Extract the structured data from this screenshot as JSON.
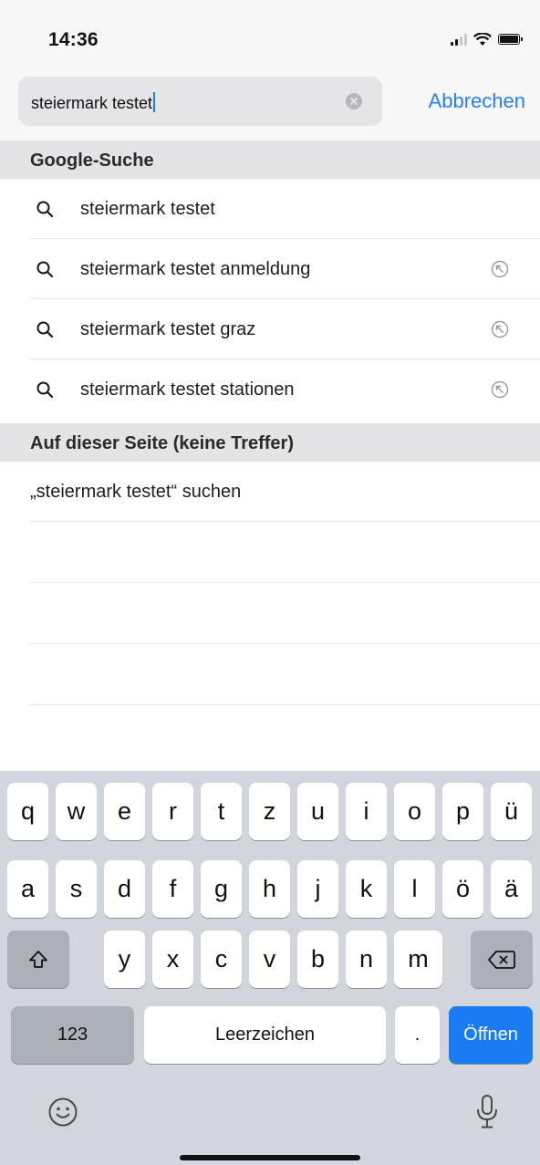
{
  "status_bar": {
    "time": "14:36",
    "icons": [
      "cellular-signal-icon",
      "wifi-icon",
      "battery-icon"
    ]
  },
  "search": {
    "value": "steiermark testet",
    "cancel_label": "Abbrechen"
  },
  "google_section": {
    "header": "Google-Suche",
    "suggestions": [
      {
        "label": "steiermark testet",
        "fill_icon": false
      },
      {
        "label": "steiermark testet anmeldung",
        "fill_icon": true
      },
      {
        "label": "steiermark testet graz",
        "fill_icon": true
      },
      {
        "label": "steiermark testet stationen",
        "fill_icon": true
      }
    ]
  },
  "page_section": {
    "header": "Auf dieser Seite (keine Treffer)",
    "find_label": "„steiermark testet“ suchen"
  },
  "keyboard": {
    "row1": [
      "q",
      "w",
      "e",
      "r",
      "t",
      "z",
      "u",
      "i",
      "o",
      "p",
      "ü"
    ],
    "row2": [
      "a",
      "s",
      "d",
      "f",
      "g",
      "h",
      "j",
      "k",
      "l",
      "ö",
      "ä"
    ],
    "row3": [
      "y",
      "x",
      "c",
      "v",
      "b",
      "n",
      "m"
    ],
    "numbers_label": "123",
    "space_label": "Leerzeichen",
    "period_label": ".",
    "go_label": "Öffnen",
    "accent_color": "#1a7cf3"
  }
}
